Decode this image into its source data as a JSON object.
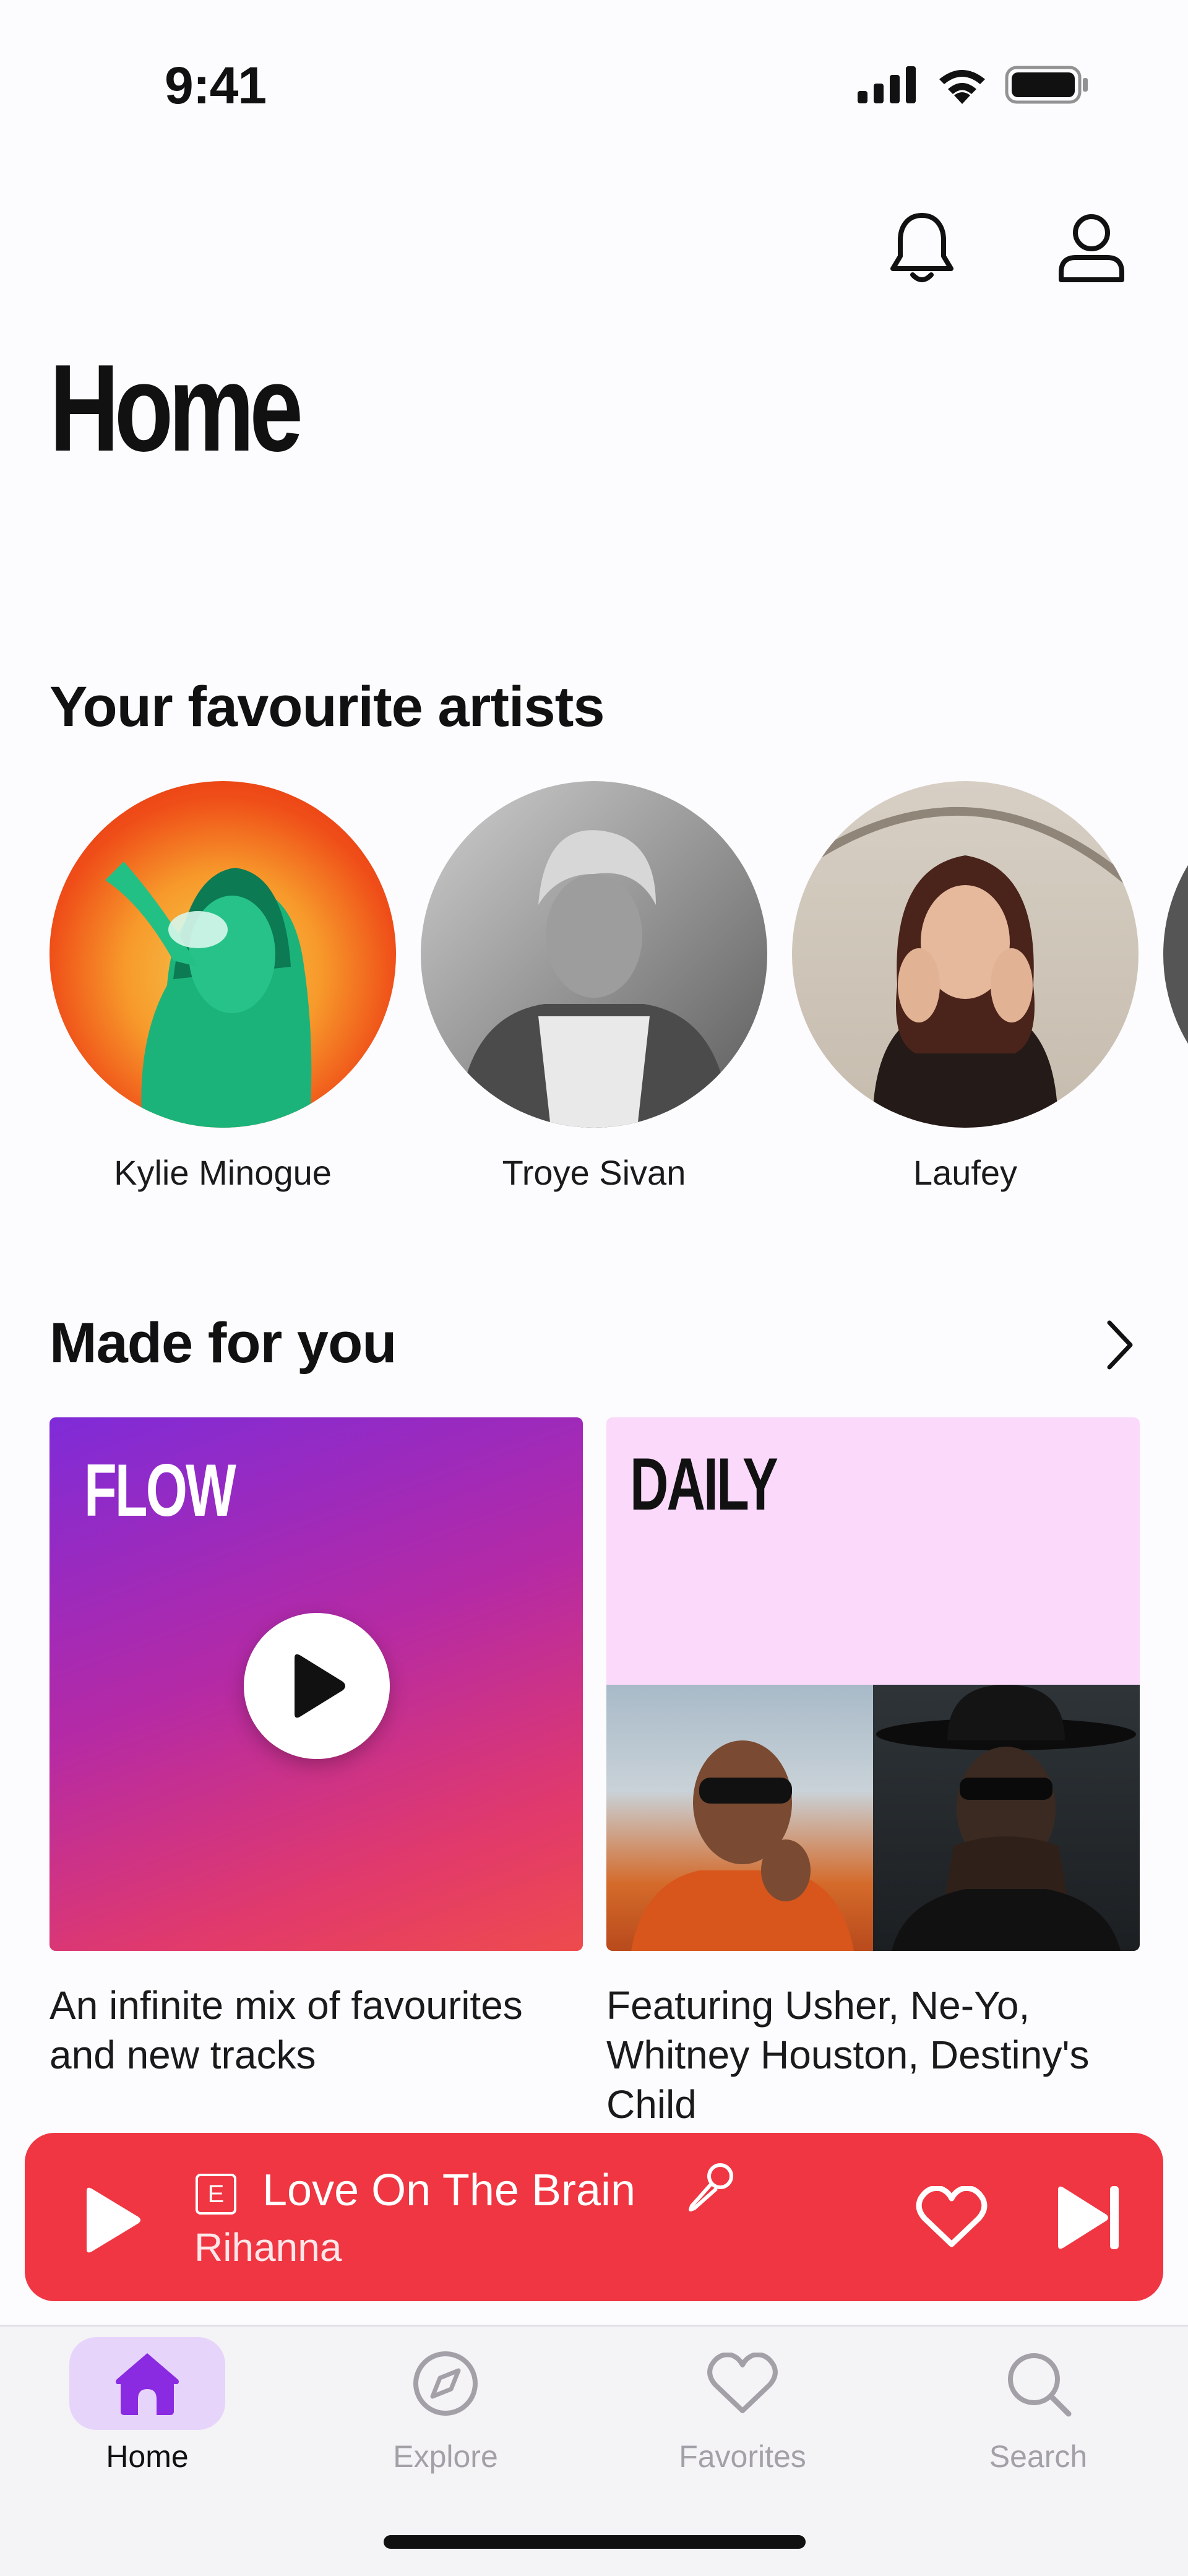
{
  "status_bar": {
    "time": "9:41"
  },
  "header": {
    "title": "Home"
  },
  "artists_section": {
    "title": "Your favourite artists",
    "artists": [
      {
        "name": "Kylie Minogue"
      },
      {
        "name": "Troye Sivan"
      },
      {
        "name": "Laufey"
      }
    ]
  },
  "made_for_you": {
    "title": "Made for you",
    "cards": [
      {
        "label": "FLOW",
        "description": "An infinite mix of favourites and new tracks"
      },
      {
        "label": "DAILY",
        "description": "Featuring Usher, Ne-Yo, Whitney Houston, Destiny's Child"
      }
    ]
  },
  "now_playing": {
    "explicit_badge": "E",
    "title": "Love On The Brain",
    "artist": "Rihanna"
  },
  "tabs": [
    {
      "label": "Home",
      "icon": "home-icon",
      "active": true
    },
    {
      "label": "Explore",
      "icon": "compass-icon",
      "active": false
    },
    {
      "label": "Favorites",
      "icon": "heart-icon",
      "active": false
    },
    {
      "label": "Search",
      "icon": "search-icon",
      "active": false
    }
  ],
  "colors": {
    "accent": "#7f2bd8",
    "now_playing_bg": "#ef3642",
    "active_tab_bg": "#e6d4fb"
  }
}
